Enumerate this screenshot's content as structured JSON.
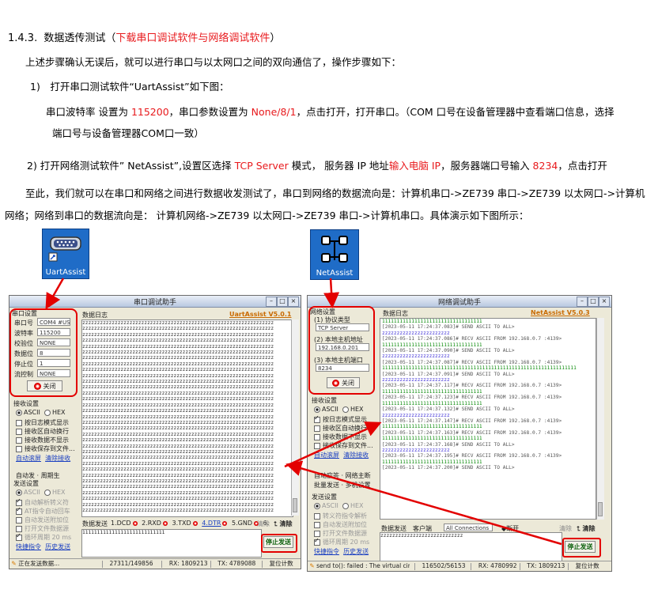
{
  "doc": {
    "heading_num": "1.4.3.",
    "heading_text": "数据透传测试（",
    "heading_red": "下载串口调试软件与网络调试软件",
    "heading_close": "）",
    "intro": "上述步骤确认无误后，就可以进行串口与以太网口之间的双向通信了，操作步骤如下：",
    "step1": "1)　打开串口测试软件“UartAssist”如下图：",
    "step1_detail": {
      "p1": "串口波特率 设置为 ",
      "baud": "115200",
      "p2": "，串口参数设置为 ",
      "params": "None/8/1",
      "p3": "，点击打开，打开串口。（COM 口号在设备管理器中查看端口信息，选择",
      "line2": "端口号与设备管理器COM口一致）"
    },
    "step2": {
      "p1": "2) 打开网络测试软件” NetAssist”,设置区选择 ",
      "mode": "TCP Server",
      "p2": " 模式， 服务器 IP 地址",
      "ip": "输入电脑 IP",
      "p3": "，服务器端口号输入 ",
      "port": "8234",
      "p4": "，点击打开"
    },
    "summary_line1": "至此，我们就可以在串口和网络之间进行数据收发测试了，串口到网络的数据流向是：计算机串口->ZE739 串口->ZE739 以太网口->计算机",
    "summary_line2": "网络；网络到串口的数据流向是： 计算机网络->ZE739 以太网口->ZE739 串口->计算机串口。具体演示如下图所示："
  },
  "icons": {
    "uart_label": "UartAssist",
    "net_label": "NetAssist",
    "uart_icon": "serial-port-icon",
    "net_icon": "network-icon"
  },
  "uart": {
    "title": "串口调试助手",
    "version": "UartAssist V5.0.1",
    "settings_group": "串口设置",
    "fields": [
      {
        "label": "串口号",
        "value": "COM4 #US"
      },
      {
        "label": "波特率",
        "value": "115200"
      },
      {
        "label": "校验位",
        "value": "NONE"
      },
      {
        "label": "数据位",
        "value": "8"
      },
      {
        "label": "停止位",
        "value": "1"
      },
      {
        "label": "流控制",
        "value": "NONE"
      }
    ],
    "close_btn": "关闭",
    "recv_group": "接收设置",
    "recv_ascii": "ASCII",
    "recv_hex": "HEX",
    "recv_opts": [
      "按日志模式显示",
      "接收区自动换行",
      "接收数据不显示",
      "接收保存到文件..."
    ],
    "recv_links": [
      "自动滚屏",
      "清除接收"
    ],
    "send_group_extra": "自动发 · 周期生",
    "send_group": "发送设置",
    "send_ascii": "ASCII",
    "send_hex": "HEX",
    "send_opts": [
      "自动解析转义符",
      "AT指令自动回车",
      "自动发送附加位",
      "打开文件数据源",
      "循环周期 20 ms"
    ],
    "send_links": [
      "快捷指令",
      "历史发送"
    ],
    "data_log_tab": "数据日志",
    "recv_line": "zzzzzzzzzzzzzzzzzzzzzzzzzzzzzzzzzzzzzzzzzzzzzzzzzzzzzzzzzzzzzzzzz",
    "send_tab": "数据发送",
    "pins": [
      "1.DCD",
      "2.RXD",
      "3.TXD",
      "4.DTR",
      "5.GND",
      "6."
    ],
    "clear_btn": "清除",
    "clear_top": "清除",
    "send_text": "1111111111111111111111111111",
    "stop_btn": "停止发送",
    "status": [
      "正在发送数据...",
      "27311/149856",
      "RX: 1809213",
      "TX: 4789088",
      "复位计数"
    ]
  },
  "net": {
    "title": "网络调试助手",
    "version": "NetAssist V5.0.3",
    "settings_group": "网络设置",
    "proto_label": "(1) 协议类型",
    "proto_value": "TCP Server",
    "host_label": "(2) 本地主机地址",
    "host_value": "192.168.0.201",
    "port_label": "(3) 本地主机端口",
    "port_value": "8234",
    "close_btn": "关闭",
    "recv_group": "接收设置",
    "recv_ascii": "ASCII",
    "recv_hex": "HEX",
    "recv_opts": [
      "按日志模式显示",
      "接收区自动换行",
      "接收数据不显示",
      "接收保存到文件..."
    ],
    "recv_links": [
      "自动滚屏",
      "清除接收"
    ],
    "auto_reply": "自动应答 · 网络主断",
    "batch_send": "批量发送 · 多机设置",
    "send_group": "发送设置",
    "send_ascii": "ASCII",
    "send_hex": "HEX",
    "send_opts": [
      "转义符指令解析",
      "自动发送附加位",
      "打开文件数据源",
      "循环周期 20 ms"
    ],
    "send_links": [
      "快捷指令",
      "历史发送"
    ],
    "data_log_tab": "数据日志",
    "log": [
      {
        "t": "1",
        "v": "1111111111111111111111111111111111"
      },
      {
        "t": "h",
        "v": "[2023-05-11 17:24:37.083]# SEND ASCII TO ALL>"
      },
      {
        "t": "z",
        "v": "zzzzzzzzzzzzzzzzzzzzzzz"
      },
      {
        "t": "h",
        "v": "[2023-05-11 17:24:37.086]# RECV ASCII FROM 192.168.0.7 :4139>"
      },
      {
        "t": "1",
        "v": "1111111111111111111111111111111111"
      },
      {
        "t": "h",
        "v": "[2023-05-11 17:24:37.090]# SEND ASCII TO ALL>"
      },
      {
        "t": "z",
        "v": "zzzzzzzzzzzzzzzzzzzzzzz"
      },
      {
        "t": "h",
        "v": "[2023-05-11 17:24:37.087]# RECV ASCII FROM 192.168.0.7 :4139>"
      },
      {
        "t": "1",
        "v": "111111111111111111111111111111111111111111111111111111111111111111"
      },
      {
        "t": "h",
        "v": "[2023-05-11 17:24:37.091]# SEND ASCII TO ALL>"
      },
      {
        "t": "z",
        "v": "zzzzzzzzzzzzzzzzzzzzzzz"
      },
      {
        "t": "h",
        "v": "[2023-05-11 17:24:37.117]# RECV ASCII FROM 192.168.0.7 :4139>"
      },
      {
        "t": "1",
        "v": "1111111111111111111111111111111111"
      },
      {
        "t": "h",
        "v": "[2023-05-11 17:24:37.123]# RECV ASCII FROM 192.168.0.7 :4139>"
      },
      {
        "t": "1",
        "v": "1111111111111111111111111111111111"
      },
      {
        "t": "h",
        "v": "[2023-05-11 17:24:37.132]# SEND ASCII TO ALL>"
      },
      {
        "t": "z",
        "v": "zzzzzzzzzzzzzzzzzzzzzzz"
      },
      {
        "t": "h",
        "v": "[2023-05-11 17:24:37.147]# RECV ASCII FROM 192.168.0.7 :4139>"
      },
      {
        "t": "1",
        "v": "1111111111111111111111111111111111"
      },
      {
        "t": "h",
        "v": "[2023-05-11 17:24:37.163]# RECV ASCII FROM 192.168.0.7 :4139>"
      },
      {
        "t": "1",
        "v": "1111111111111111111111111111111111"
      },
      {
        "t": "h",
        "v": "[2023-05-11 17:24:37.168]# SEND ASCII TO ALL>"
      },
      {
        "t": "z",
        "v": "zzzzzzzzzzzzzzzzzzzzzzz"
      },
      {
        "t": "h",
        "v": "[2023-05-11 17:24:37.195]# RECV ASCII FROM 192.168.0.7 :4139>"
      },
      {
        "t": "1",
        "v": "1111111111111111111111111111111111"
      },
      {
        "t": "h",
        "v": "[2023-05-11 17:24:37.200]# SEND ASCII TO ALL>"
      }
    ],
    "send_tab": "数据发送",
    "clients_tab": "客户端",
    "connections": "All Connections",
    "disconnect_btn": "断开",
    "clear_btn": "清除",
    "clear_top": "清除",
    "send_text": "zzzzzzzzzzzzzzzzzzzzzzzzzzzz",
    "stop_btn": "停止发送",
    "status": [
      "send to(): failed : The virtual circ",
      "116502/56153",
      "RX: 4780992",
      "TX: 1809213",
      "复位计数"
    ]
  }
}
